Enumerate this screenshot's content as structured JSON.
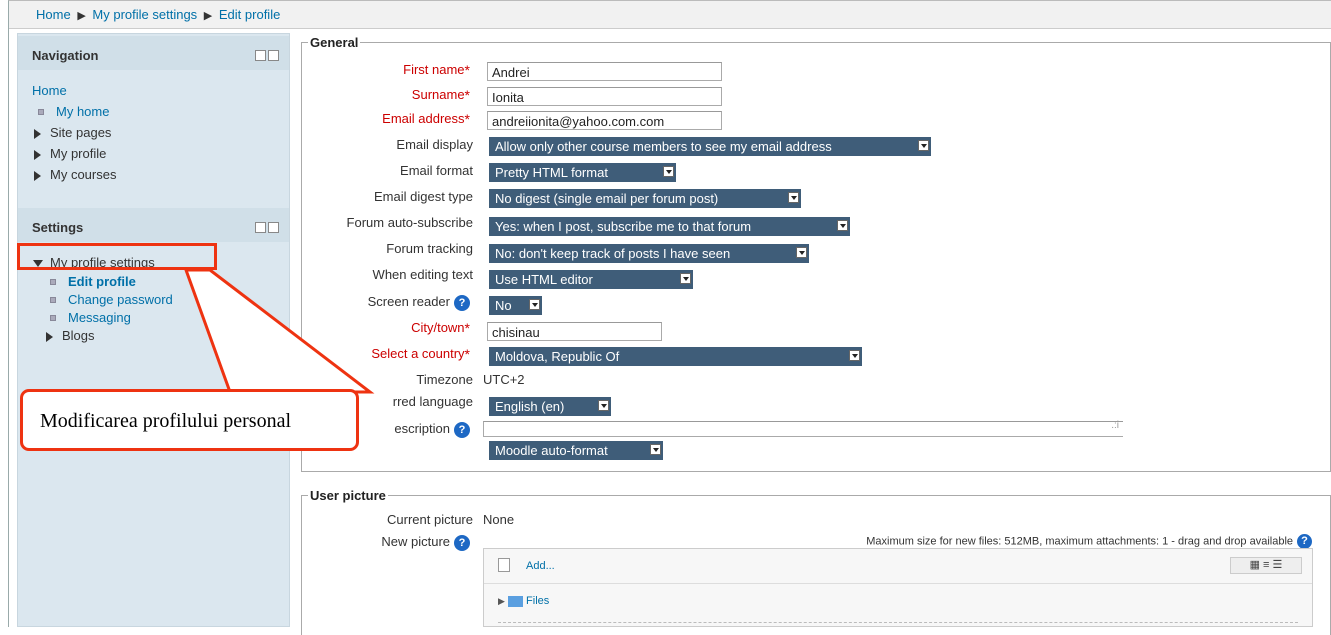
{
  "breadcrumb": {
    "items": [
      "Home",
      "My profile settings",
      "Edit profile"
    ]
  },
  "navigation": {
    "title": "Navigation",
    "home": "Home",
    "items": [
      "My home",
      "Site pages",
      "My profile",
      "My courses"
    ]
  },
  "settings": {
    "title": "Settings",
    "section": "My profile settings",
    "items": [
      "Edit profile",
      "Change password",
      "Messaging",
      "Blogs"
    ]
  },
  "callout": {
    "text": "Modificarea profilului personal"
  },
  "general": {
    "legend": "General",
    "first_name_label": "First name",
    "first_name_value": "Andrei",
    "surname_label": "Surname",
    "surname_value": "Ionita",
    "email_label": "Email address",
    "email_value": "andreiionita@yahoo.com.com",
    "email_display_label": "Email display",
    "email_display_value": "Allow only other course members to see my email address",
    "email_format_label": "Email format",
    "email_format_value": "Pretty HTML format",
    "digest_label": "Email digest type",
    "digest_value": "No digest (single email per forum post)",
    "autosub_label": "Forum auto-subscribe",
    "autosub_value": "Yes: when I post, subscribe me to that forum",
    "tracking_label": "Forum tracking",
    "tracking_value": "No: don't keep track of posts I have seen",
    "editing_label": "When editing text",
    "editing_value": "Use HTML editor",
    "reader_label": "Screen reader",
    "reader_value": "No",
    "city_label": "City/town",
    "city_value": "chisinau",
    "country_label": "Select a country",
    "country_value": "Moldova, Republic Of",
    "timezone_label": "Timezone",
    "timezone_value": "UTC+2",
    "language_label": "rred language",
    "language_value": "English (en)",
    "description_label": "escription",
    "format_value": "Moodle auto-format"
  },
  "picture": {
    "legend": "User picture",
    "current_label": "Current picture",
    "current_value": "None",
    "new_label": "New picture",
    "limits": "Maximum size for new files: 512MB, maximum attachments: 1 - drag and drop available",
    "add_label": "Add...",
    "files_label": "Files"
  }
}
